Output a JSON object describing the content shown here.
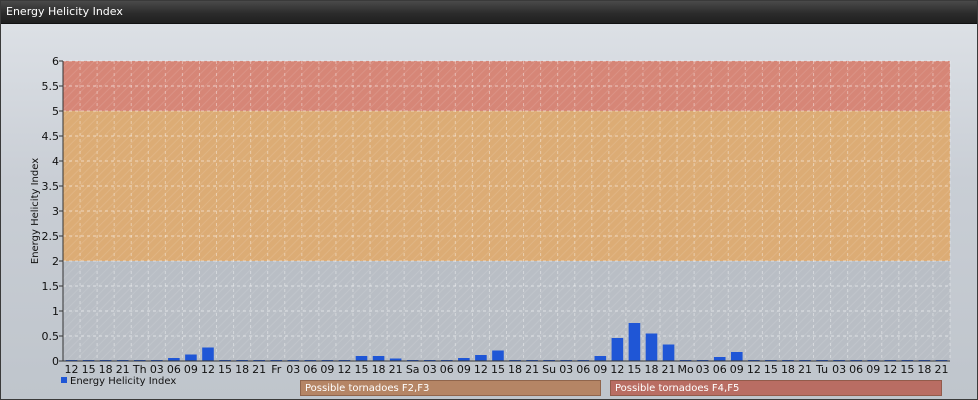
{
  "window": {
    "title": "Energy Helicity Index"
  },
  "legend": {
    "series_label": "Energy Helicity Index"
  },
  "band_labels": [
    "Possible tornadoes F2,F3",
    "Possible tornadoes F4,F5"
  ],
  "colors": {
    "bar": "#1f56d6",
    "band_low": "#e8a55a",
    "band_high": "#e0735c",
    "grid": "#ffffff"
  },
  "chart_data": {
    "type": "bar",
    "title": "Energy Helicity Index",
    "xlabel": "",
    "ylabel": "Energy Helicity Index",
    "ylim": [
      0,
      6
    ],
    "yticks": [
      "0",
      "0.5",
      "1",
      "1.5",
      "2",
      "2.5",
      "3",
      "3.5",
      "4",
      "4.5",
      "5",
      "5.5",
      "6"
    ],
    "grid": true,
    "legend_position": "bottom-left",
    "bands": [
      {
        "from": 2,
        "to": 5,
        "label": "Possible tornadoes F2,F3"
      },
      {
        "from": 5,
        "to": 6,
        "label": "Possible tornadoes F4,F5"
      }
    ],
    "categories": [
      "12",
      "15",
      "18",
      "21",
      "Th",
      "03",
      "06",
      "09",
      "12",
      "15",
      "18",
      "21",
      "Fr",
      "03",
      "06",
      "09",
      "12",
      "15",
      "18",
      "21",
      "Sa",
      "03",
      "06",
      "09",
      "12",
      "15",
      "18",
      "21",
      "Su",
      "03",
      "06",
      "09",
      "12",
      "15",
      "18",
      "21",
      "Mo",
      "03",
      "06",
      "09",
      "12",
      "15",
      "18",
      "21",
      "Tu",
      "03",
      "06",
      "09",
      "12",
      "15",
      "18",
      "21"
    ],
    "series": [
      {
        "name": "Energy Helicity Index",
        "values": [
          0.02,
          0.02,
          0.02,
          0.02,
          0.02,
          0.02,
          0.06,
          0.13,
          0.27,
          0.02,
          0.02,
          0.02,
          0.02,
          0.02,
          0.02,
          0.02,
          0.02,
          0.1,
          0.1,
          0.05,
          0.02,
          0.02,
          0.02,
          0.06,
          0.12,
          0.21,
          0.02,
          0.02,
          0.02,
          0.02,
          0.02,
          0.1,
          0.46,
          0.76,
          0.55,
          0.33,
          0.02,
          0.02,
          0.08,
          0.18,
          0.02,
          0.02,
          0.02,
          0.02,
          0.02,
          0.02,
          0.02,
          0.02,
          0.02,
          0.02,
          0.02,
          0.02
        ]
      }
    ]
  }
}
